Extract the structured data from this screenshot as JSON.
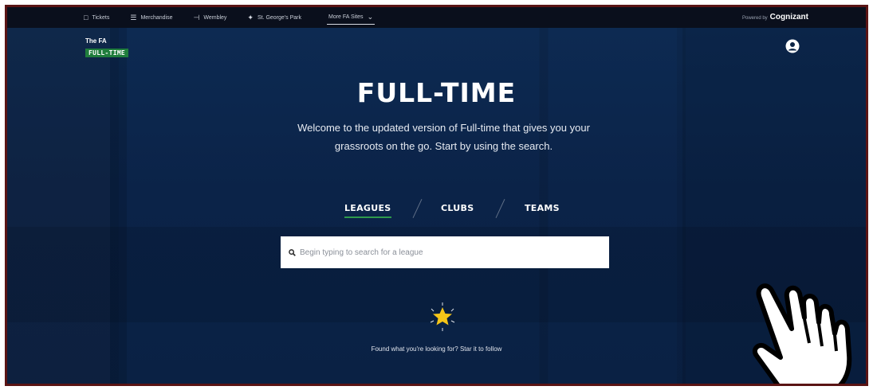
{
  "topbar": {
    "links": [
      {
        "icon": "ticket-icon",
        "label": "Tickets"
      },
      {
        "icon": "shopping-cart-icon",
        "label": "Merchandise"
      },
      {
        "icon": "stadium-icon",
        "label": "Wembley"
      },
      {
        "icon": "plane-icon",
        "label": "St. George's Park"
      }
    ],
    "more_label": "More FA Sites",
    "powered_by": "Powered by",
    "sponsor": "Cognizant"
  },
  "logo": {
    "line1": "The FA",
    "line2": "FULL-TIME"
  },
  "hero": {
    "title": "FULL-TIME",
    "welcome_line1": "Welcome to the updated version of Full-time that gives you your",
    "welcome_line2": "grassroots on the go. Start by using the search."
  },
  "tabs": [
    {
      "label": "LEAGUES",
      "active": true
    },
    {
      "label": "CLUBS",
      "active": false
    },
    {
      "label": "TEAMS",
      "active": false
    }
  ],
  "search": {
    "placeholder": "Begin typing to search for a league",
    "value": ""
  },
  "follow_text": "Found what you're looking for? Star it to follow",
  "colors": {
    "background": "#0c2446",
    "topbar": "#0a0f1c",
    "accent_green": "#1f7d3c",
    "star": "#f5c518",
    "frame_border": "#5a1414"
  }
}
